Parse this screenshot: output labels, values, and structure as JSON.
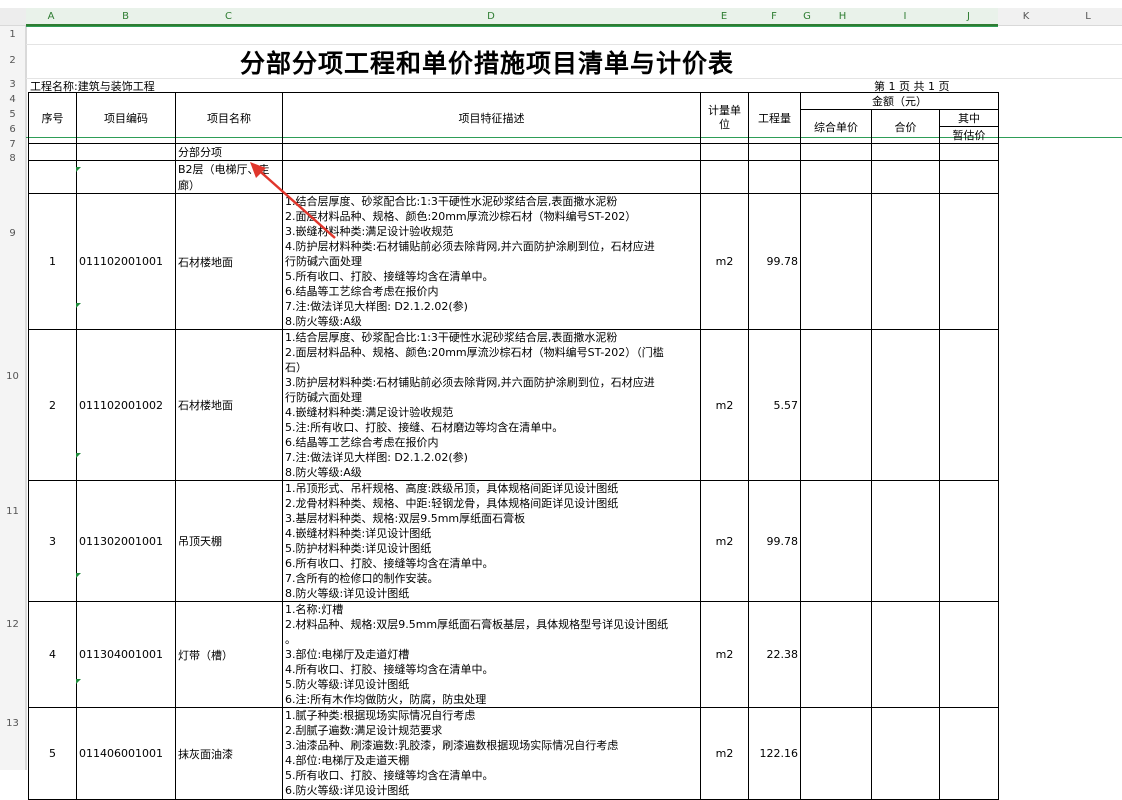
{
  "column_headers": [
    "A",
    "B",
    "C",
    "D",
    "E",
    "F",
    "G",
    "H",
    "I",
    "J",
    "K",
    "L"
  ],
  "row_numbers": [
    "1",
    "2",
    "3",
    "4",
    "5",
    "6",
    "7",
    "8",
    "9",
    "10",
    "11",
    "12",
    "13"
  ],
  "sheet": {
    "title": "分部分项工程和单价措施项目清单与计价表",
    "project_label": "工程名称:建筑与装饰工程",
    "page_label": "第  1  页  共  1  页"
  },
  "table_header": {
    "seq": "序号",
    "code": "项目编码",
    "name": "项目名称",
    "desc": "项目特征描述",
    "unit": "计量单位",
    "qty": "工程量",
    "amount": "金额（元）",
    "unit_price": "综合单价",
    "total": "合价",
    "of_which": "其中",
    "provisional": "暂估价"
  },
  "section_rows": {
    "row7": "分部分项",
    "row8": "B2层（电梯厅、走廊）"
  },
  "items": [
    {
      "seq": "1",
      "code": "011102001001",
      "name": "石材楼地面",
      "unit": "m2",
      "qty": "99.78",
      "desc": [
        "1.结合层厚度、砂浆配合比:1:3干硬性水泥砂浆结合层,表面撒水泥粉",
        "2.面层材料品种、规格、颜色:20mm厚流沙棕石材（物料编号ST-202）",
        "3.嵌缝材料种类:满足设计验收规范",
        "4.防护层材料种类:石材铺贴前必须去除背网,并六面防护涂刷到位，石材应进",
        "行防碱六面处理",
        "5.所有收口、打胶、接缝等均含在清单中。",
        "6.结晶等工艺综合考虑在报价内",
        "7.注:做法详见大样图: D2.1.2.02(参)",
        "8.防火等级:A级"
      ]
    },
    {
      "seq": "2",
      "code": "011102001002",
      "name": "石材楼地面",
      "unit": "m2",
      "qty": "5.57",
      "desc": [
        "1.结合层厚度、砂浆配合比:1:3干硬性水泥砂浆结合层,表面撒水泥粉",
        "2.面层材料品种、规格、颜色:20mm厚流沙棕石材（物料编号ST-202）（门槛",
        "石）",
        "3.防护层材料种类:石材铺贴前必须去除背网,并六面防护涂刷到位，石材应进",
        "行防碱六面处理",
        "4.嵌缝材料种类:满足设计验收规范",
        "5.注:所有收口、打胶、接缝、石材磨边等均含在清单中。",
        "6.结晶等工艺综合考虑在报价内",
        "7.注:做法详见大样图: D2.1.2.02(参)",
        "8.防火等级:A级"
      ]
    },
    {
      "seq": "3",
      "code": "011302001001",
      "name": "吊顶天棚",
      "unit": "m2",
      "qty": "99.78",
      "desc": [
        "1.吊顶形式、吊杆规格、高度:跌级吊顶，具体规格间距详见设计图纸",
        "2.龙骨材料种类、规格、中距:轻钢龙骨，具体规格间距详见设计图纸",
        "3.基层材料种类、规格:双层9.5mm厚纸面石膏板",
        "4.嵌缝材料种类:详见设计图纸",
        "5.防护材料种类:详见设计图纸",
        "6.所有收口、打胶、接缝等均含在清单中。",
        "7.含所有的检修口的制作安装。",
        "8.防火等级:详见设计图纸"
      ]
    },
    {
      "seq": "4",
      "code": "011304001001",
      "name": "灯带（槽）",
      "unit": "m2",
      "qty": "22.38",
      "desc": [
        "1.名称:灯槽",
        "2.材料品种、规格:双层9.5mm厚纸面石膏板基层，具体规格型号详见设计图纸",
        "。",
        "3.部位:电梯厅及走道灯槽",
        "4.所有收口、打胶、接缝等均含在清单中。",
        "5.防火等级:详见设计图纸",
        "6.注:所有木作均做防火，防腐，防虫处理"
      ]
    },
    {
      "seq": "5",
      "code": "011406001001",
      "name": "抹灰面油漆",
      "unit": "m2",
      "qty": "122.16",
      "desc": [
        "1.腻子种类:根据现场实际情况自行考虑",
        "2.刮腻子遍数:满足设计规范要求",
        "3.油漆品种、刷漆遍数:乳胶漆，刷漆遍数根据现场实际情况自行考虑",
        "4.部位:电梯厅及走道天棚",
        "5.所有收口、打胶、接缝等均含在清单中。",
        "6.防火等级:详见设计图纸"
      ]
    }
  ],
  "colors": {
    "accent": "#2e9d57",
    "arrow": "#e0362c"
  }
}
